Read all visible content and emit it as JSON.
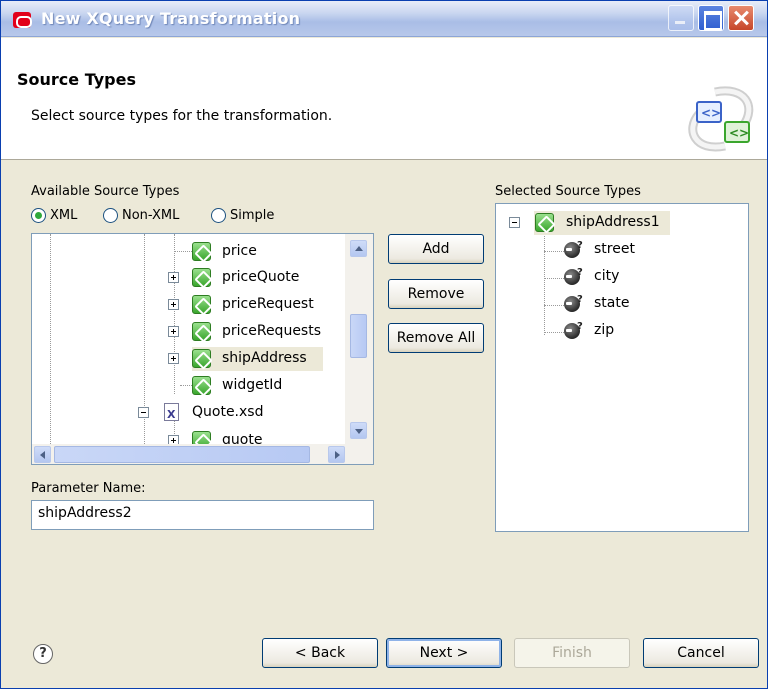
{
  "window": {
    "title": "New XQuery Transformation"
  },
  "header": {
    "title": "Source Types",
    "description": "Select source types for the transformation."
  },
  "available": {
    "label": "Available Source Types",
    "radios": [
      {
        "label": "XML",
        "checked": true
      },
      {
        "label": "Non-XML",
        "checked": false
      },
      {
        "label": "Simple",
        "checked": false
      }
    ],
    "tree": [
      {
        "label": "price"
      },
      {
        "label": "priceQuote"
      },
      {
        "label": "priceRequest"
      },
      {
        "label": "priceRequests"
      },
      {
        "label": "shipAddress"
      },
      {
        "label": "widgetId"
      },
      {
        "label": "Quote.xsd"
      },
      {
        "label": "quote"
      }
    ]
  },
  "middle_buttons": {
    "add": "Add",
    "remove": "Remove",
    "remove_all": "Remove All"
  },
  "parameter": {
    "label": "Parameter Name:",
    "value": "shipAddress2"
  },
  "selected": {
    "label": "Selected Source Types",
    "root": "shipAddress1",
    "children": [
      "street",
      "city",
      "state",
      "zip"
    ]
  },
  "footer": {
    "help": "?",
    "back": "< Back",
    "next": "Next >",
    "finish": "Finish",
    "cancel": "Cancel"
  },
  "colors": {
    "title_bar": "#a9bde6",
    "panel_border": "#7f9db9",
    "button_border": "#003c74",
    "tree_icon_green": "#3aa62d"
  }
}
